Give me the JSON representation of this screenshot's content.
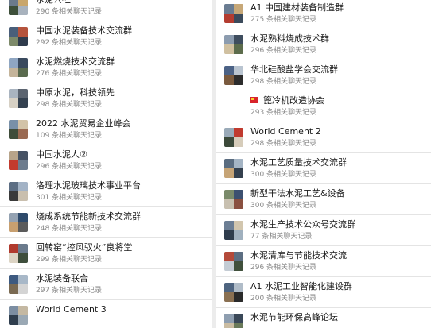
{
  "left_column": [
    {
      "name": "水泥公社",
      "count": "290 条相关聊天记录",
      "avatar_colors": [
        "#6b7a8c",
        "#c9a66b",
        "#3d4f3a",
        "#a8b2bd"
      ]
    },
    {
      "name": "中国水泥装备技术交流群",
      "count": "292 条相关聊天记录",
      "avatar_colors": [
        "#4a5f7a",
        "#b5533c",
        "#7d8a6a",
        "#2f3b4c"
      ]
    },
    {
      "name": "水泥燃烧技术交流群",
      "count": "276 条相关聊天记录",
      "avatar_colors": [
        "#8fa6c2",
        "#3a4a5e",
        "#c4b49a",
        "#5a6b4f"
      ]
    },
    {
      "name": "中原水泥，科技领先",
      "count": "298 条相关聊天记录",
      "avatar_colors": [
        "#a9b4c0",
        "#5b6470",
        "#d6d0c4",
        "#344150"
      ]
    },
    {
      "name": "2022 水泥贸易企业峰会",
      "count": "109 条相关聊天记录",
      "avatar_colors": [
        "#7890a8",
        "#d2c3a8",
        "#3f4d3a",
        "#9a6a52"
      ]
    },
    {
      "name": "中国水泥人②",
      "count": "296 条相关聊天记录",
      "avatar_colors": [
        "#b8a48a",
        "#465264",
        "#c23a2e",
        "#6d7c8e"
      ]
    },
    {
      "name": "洛理水泥玻璃技术事业平台",
      "count": "301 条相关聊天记录",
      "avatar_colors": [
        "#5c6e84",
        "#a3b3c6",
        "#3a3a3a",
        "#c9bfae"
      ]
    },
    {
      "name": "烧成系统节能新技术交流群",
      "count": "248 条相关聊天记录",
      "avatar_colors": [
        "#94a2b2",
        "#2e4a6b",
        "#c8a070",
        "#5b5b5b"
      ]
    },
    {
      "name": "回转窑“控风驭火”良将堂",
      "count": "299 条相关聊天记录",
      "avatar_colors": [
        "#b03a2e",
        "#6a7a8c",
        "#dcd4c4",
        "#3e4e3c"
      ]
    },
    {
      "name": "水泥装备联合",
      "count": "297 条相关聊天记录",
      "avatar_colors": [
        "#3d5a80",
        "#a8b8c8",
        "#7a6a52",
        "#d4d4d4"
      ]
    },
    {
      "name": "World Cement 3",
      "count": "",
      "avatar_colors": [
        "#7c8ea2",
        "#c4b8a2",
        "#2f3e4e",
        "#9aa8b4"
      ]
    }
  ],
  "right_column": [
    {
      "name": "A1 中国建材装备制造群",
      "count": "275 条相关聊天记录",
      "avatar_colors": [
        "#6a7c92",
        "#c7a878",
        "#b43c30",
        "#3b4a5b"
      ],
      "flag": false
    },
    {
      "name": "水泥熟料烧成技术群",
      "count": "296 条相关聊天记录",
      "avatar_colors": [
        "#8c9caf",
        "#3e4d5e",
        "#d0c0a0",
        "#5c6c4c"
      ],
      "flag": false
    },
    {
      "name": "华北硅酸盐学会交流群",
      "count": "298 条相关聊天记录",
      "avatar_colors": [
        "#4b6286",
        "#b9c4d0",
        "#7a5a3e",
        "#2c2c2c"
      ],
      "flag": false
    },
    {
      "name": "篦冷机改造协会",
      "count": "293 条相关聊天记录",
      "avatar_colors": [],
      "flag": true
    },
    {
      "name": "World Cement 2",
      "count": "298 条相关聊天记录",
      "avatar_colors": [
        "#9aaab8",
        "#c03a2e",
        "#3c4a3a",
        "#d6ccba"
      ],
      "flag": false
    },
    {
      "name": "水泥工艺质量技术交流群",
      "count": "300 条相关聊天记录",
      "avatar_colors": [
        "#5a6c80",
        "#a4b4c4",
        "#c6a476",
        "#34404e"
      ],
      "flag": false
    },
    {
      "name": "新型干法水泥工艺&设备",
      "count": "300 条相关聊天记录",
      "avatar_colors": [
        "#7a8a6a",
        "#3c5070",
        "#c8c0b0",
        "#8a5040"
      ],
      "flag": false
    },
    {
      "name": "水泥生产技术公众号交流群",
      "count": "77 条相关聊天记录",
      "avatar_colors": [
        "#6c7e94",
        "#d2c6ae",
        "#2e3c4c",
        "#a0b0be"
      ],
      "flag": false
    },
    {
      "name": "水泥清库与节能技术交流",
      "count": "296 条相关聊天记录",
      "avatar_colors": [
        "#b44a3a",
        "#5c6e82",
        "#c4ccd4",
        "#40503c"
      ],
      "flag": false
    },
    {
      "name": "A1 水泥工业智能化建设群",
      "count": "200 条相关聊天记录",
      "avatar_colors": [
        "#4e6480",
        "#b0bcc8",
        "#8a7052",
        "#2a2a2a"
      ],
      "flag": false
    },
    {
      "name": "水泥节能环保高峰论坛",
      "count": "",
      "avatar_colors": [
        "#8e9eb0",
        "#3a4858",
        "#cabca2",
        "#6a7a5a"
      ],
      "flag": false
    }
  ]
}
